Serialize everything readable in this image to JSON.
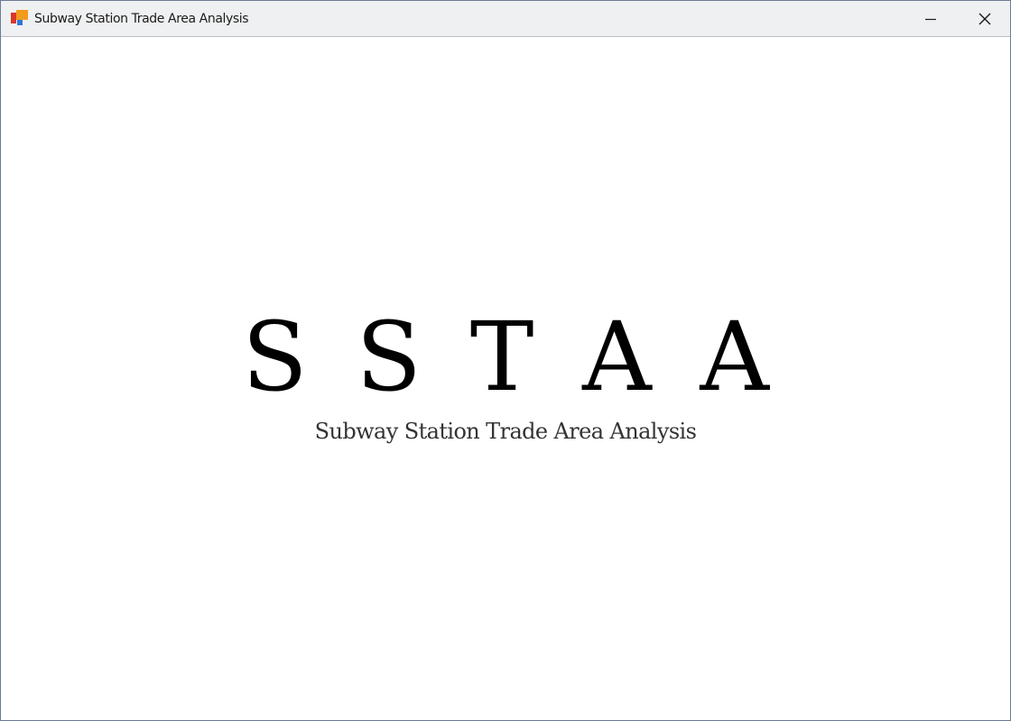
{
  "window": {
    "title": "Subway Station Trade Area Analysis",
    "app_icon": "app-logo-icon",
    "controls": {
      "minimize_icon": "minimize-icon",
      "close_icon": "close-icon"
    }
  },
  "main": {
    "logo_text": "S S T A A",
    "subtitle": "Subway Station Trade Area Analysis"
  },
  "colors": {
    "titlebar_bg": "#eff0f1",
    "logo_text": "#000000",
    "subtitle_text": "#333333",
    "icon_red": "#d9362b",
    "icon_orange": "#f29b1d",
    "icon_blue": "#2f79d6"
  }
}
